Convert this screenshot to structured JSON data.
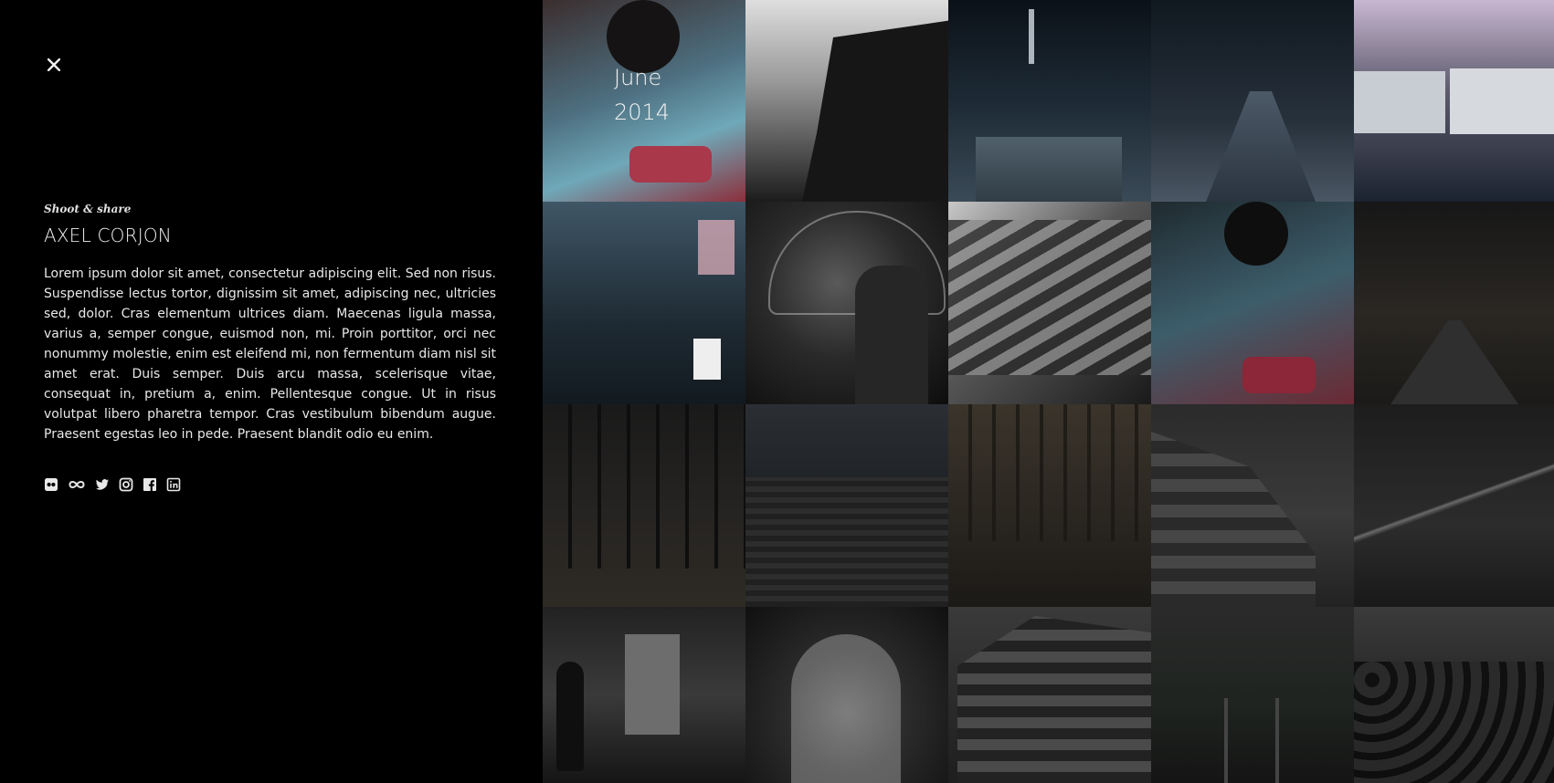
{
  "close": {
    "icon": "close-icon"
  },
  "profile": {
    "kicker": "Shoot & share",
    "name": "AXEL CORJON",
    "description": "Lorem ipsum dolor sit amet, consectetur adipiscing elit. Sed non risus. Suspendisse lectus tortor, dignissim sit amet, adipiscing nec, ultricies sed, dolor. Cras elementum ultrices diam. Maecenas ligula massa, varius a, semper congue, euismod non, mi. Proin porttitor, orci nec nonummy molestie, enim est eleifend mi, non fermentum diam nisl sit amet erat. Duis semper. Duis arcu massa, scelerisque vitae, consequat in, pretium a, enim. Pellentesque congue. Ut in risus volutpat libero pharetra tempor. Cras vestibulum bibendum augue. Praesent egestas leo in pede. Praesent blandit odio eu enim."
  },
  "socials": [
    {
      "icon": "flickr-icon"
    },
    {
      "icon": "infinity-icon"
    },
    {
      "icon": "twitter-icon"
    },
    {
      "icon": "instagram-icon"
    },
    {
      "icon": "facebook-icon"
    },
    {
      "icon": "linkedin-icon"
    }
  ],
  "overlay": {
    "month": "June",
    "year": "2014"
  },
  "gallery": {
    "tiles": [
      "kimono",
      "pagoda",
      "night-street",
      "night-street-2",
      "bus-station",
      "alley-stairs",
      "umbrella-man",
      "temple-roof",
      "kimono-2",
      "forest-road",
      "bare-forest",
      "city-aerial",
      "swamp-forest",
      "paris-building",
      "suspension-bridge",
      "tunnel-stairs",
      "archway",
      "corner-building",
      "railway",
      "crowd"
    ]
  },
  "colors": {
    "background": "#000000",
    "text": "#e8e8e8"
  }
}
